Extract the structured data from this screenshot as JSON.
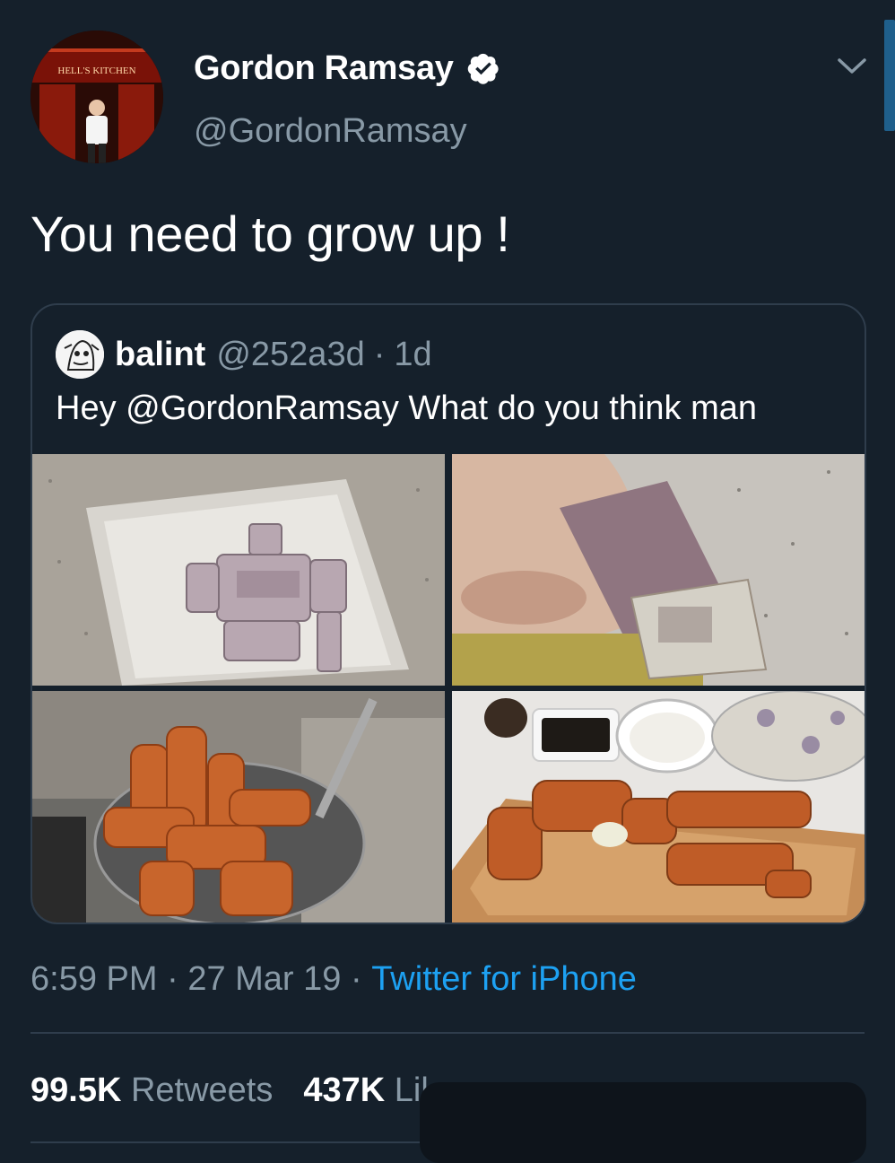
{
  "tweet": {
    "author": {
      "display_name": "Gordon Ramsay",
      "handle": "@GordonRamsay",
      "verified": true,
      "avatar_sign": "HELL'S KITCHEN"
    },
    "text": "You need to grow up !",
    "quoted": {
      "name": "balint",
      "handle": "@252a3d",
      "separator": "·",
      "time": "1d",
      "text": "Hey @GordonRamsay What do you think man",
      "photos": [
        "gundam-model-in-batter",
        "coating-gundam-in-breadcrumbs",
        "fried-gundam-parts-in-strainer",
        "fried-gundam-plated-on-board"
      ]
    },
    "timestamp": {
      "time": "6:59 PM",
      "separator": " · ",
      "date": "27 Mar 19",
      "separator2": " · ",
      "source": "Twitter for iPhone"
    },
    "stats": {
      "retweets_count": "99.5K",
      "retweets_label": " Retweets",
      "likes_count": "437K",
      "likes_label": " Likes"
    }
  },
  "icons": {
    "verified": "verified-badge-icon",
    "caret": "chevron-down-icon"
  },
  "colors": {
    "background": "#15202b",
    "secondary_text": "#8899a6",
    "link": "#1da1f2",
    "border": "#2f3d4c"
  }
}
